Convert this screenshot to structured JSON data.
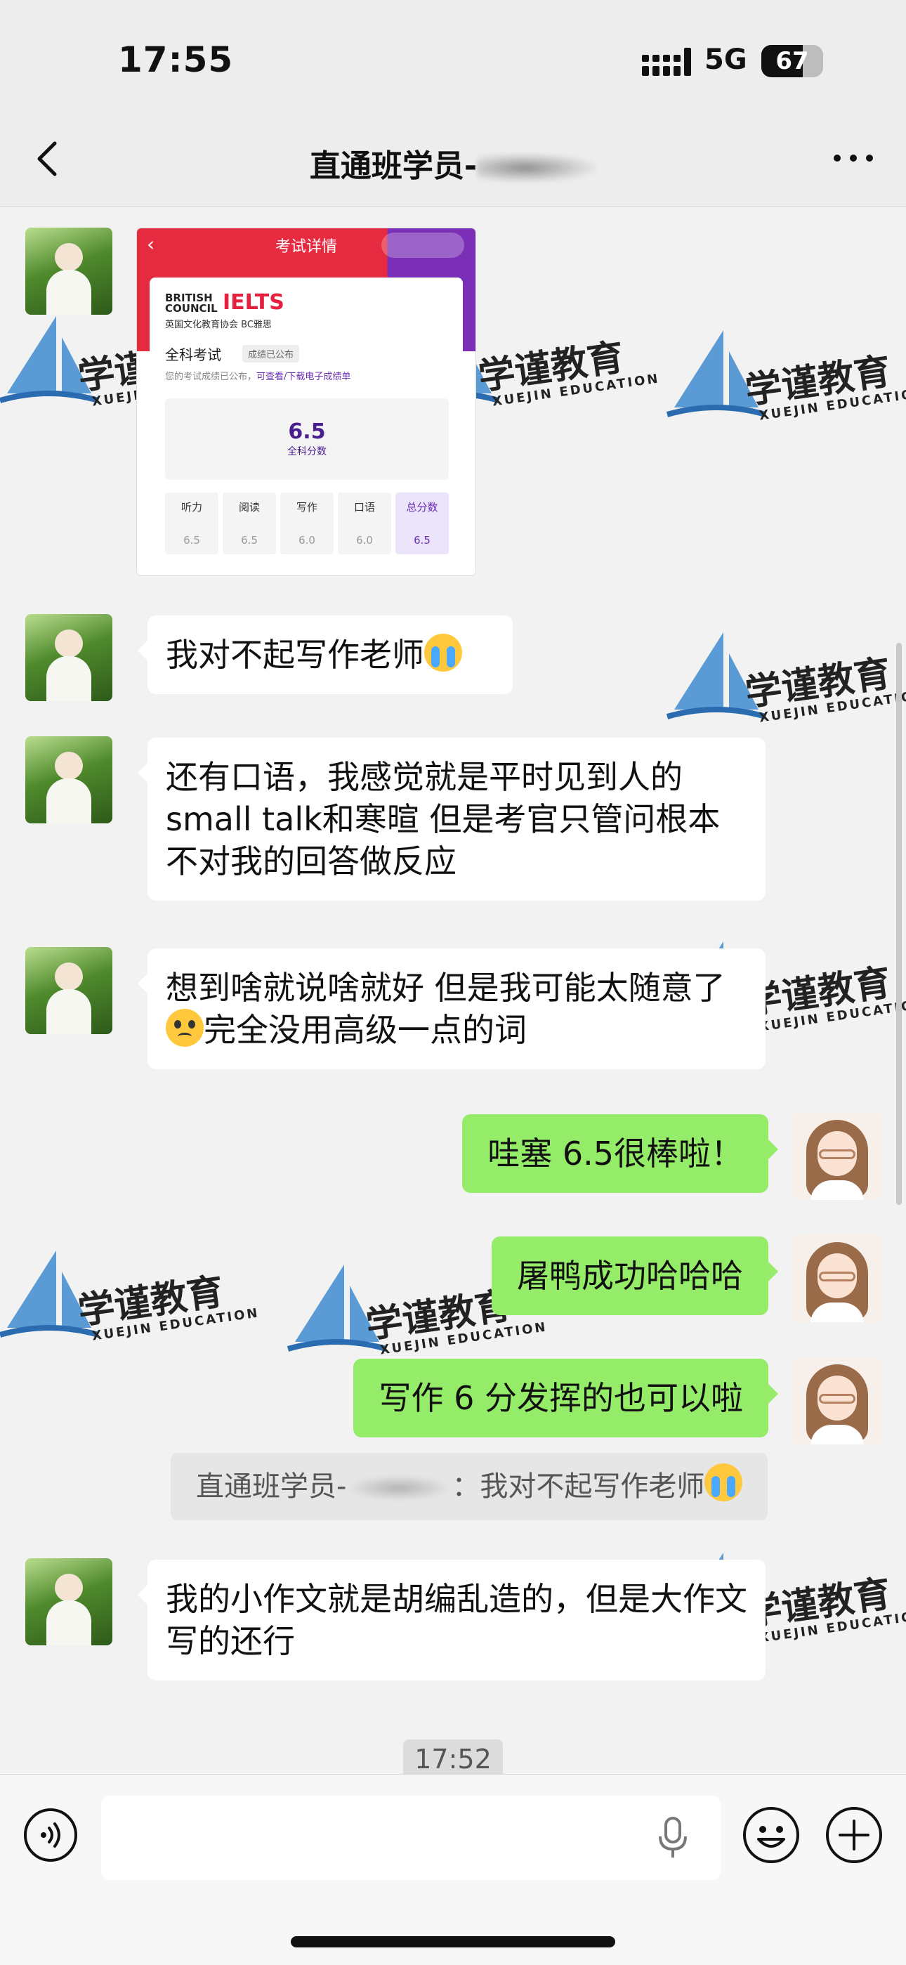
{
  "status": {
    "time": "17:55",
    "network": "5G",
    "battery": "67",
    "battery_level": 0.67
  },
  "nav": {
    "title": "直通班学员-"
  },
  "watermark": {
    "cn": "学谨教育",
    "en": "XUEJIN EDUCATION"
  },
  "ielts_card": {
    "header_title": "考试详情",
    "logo_line1": "BRITISH",
    "logo_line2": "COUNCIL",
    "brand": "IELTS",
    "brand_sub": "英国文化教育协会 BC雅思",
    "exam_title": "全科考试",
    "status_badge": "成绩已公布",
    "note_prefix": "您的考试成绩已公布，",
    "note_link": "可查看/下载电子成绩单",
    "overall_score": "6.5",
    "overall_label": "全科分数",
    "sections": [
      {
        "name": "听力",
        "score": "6.5"
      },
      {
        "name": "阅读",
        "score": "6.5"
      },
      {
        "name": "写作",
        "score": "6.0"
      },
      {
        "name": "口语",
        "score": "6.0"
      },
      {
        "name": "总分数",
        "score": "6.5"
      }
    ]
  },
  "messages": {
    "m1": "我对不起写作老师",
    "m2": "还有口语，我感觉就是平时见到人的small talk和寒暄 但是考官只管问根本不对我的回答做反应",
    "m3_a": "想到啥就说啥就好 但是我可能太随意了",
    "m3_b": "完全没用高级一点的词",
    "r1": "哇塞 6.5很棒啦！",
    "r2": "屠鸭成功哈哈哈",
    "r3": "写作 6 分发挥的也可以啦",
    "quote_prefix": "直通班学员-",
    "quote_suffix": "：我对不起写作老师",
    "m4": "我的小作文就是胡编乱造的，但是大作文写的还行"
  },
  "timestamp": "17:52",
  "icons": {
    "back": "chevron-left-icon",
    "more": "more-dots-icon",
    "voice": "voice-icon",
    "mic": "mic-icon",
    "emoji": "emoji-icon",
    "plus": "plus-icon"
  }
}
